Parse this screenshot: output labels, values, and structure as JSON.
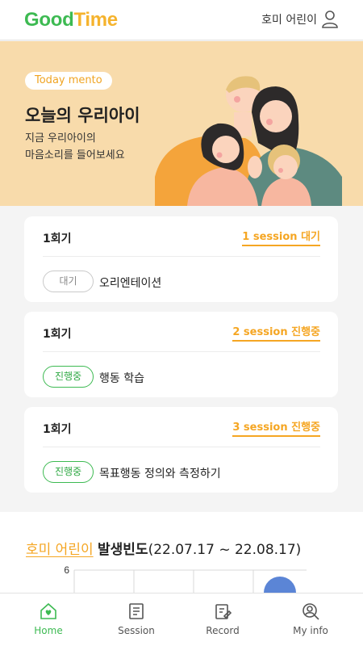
{
  "header": {
    "logo_good": "Good",
    "logo_time": "Time",
    "user_name": "호미 어린이"
  },
  "hero": {
    "badge": "Today mento",
    "title": "오늘의 우리아이",
    "subtitle_line1": "지금 우리아이의",
    "subtitle_line2": "마음소리를 들어보세요"
  },
  "sessions": [
    {
      "round": "1회기",
      "session": "1 session 대기",
      "tag": "대기",
      "task": "오리엔테이션"
    },
    {
      "round": "1회기",
      "session": "2 session 진행중",
      "tag": "진행중",
      "task": "행동 학습"
    },
    {
      "round": "1회기",
      "session": "3 session 진행중",
      "tag": "진행중",
      "task": "목표행동 정의와 측정하기"
    }
  ],
  "stats": {
    "child_name": "호미 어린이",
    "label": "발생빈도",
    "range": "(22.07.17 ~ 22.08.17)",
    "y_tick": "6"
  },
  "nav": {
    "items": [
      {
        "label": "Home"
      },
      {
        "label": "Session"
      },
      {
        "label": "Record"
      },
      {
        "label": "My info"
      }
    ]
  },
  "colors": {
    "green": "#3dba52",
    "orange": "#f5a623",
    "hero_bg": "#f8dbab"
  }
}
